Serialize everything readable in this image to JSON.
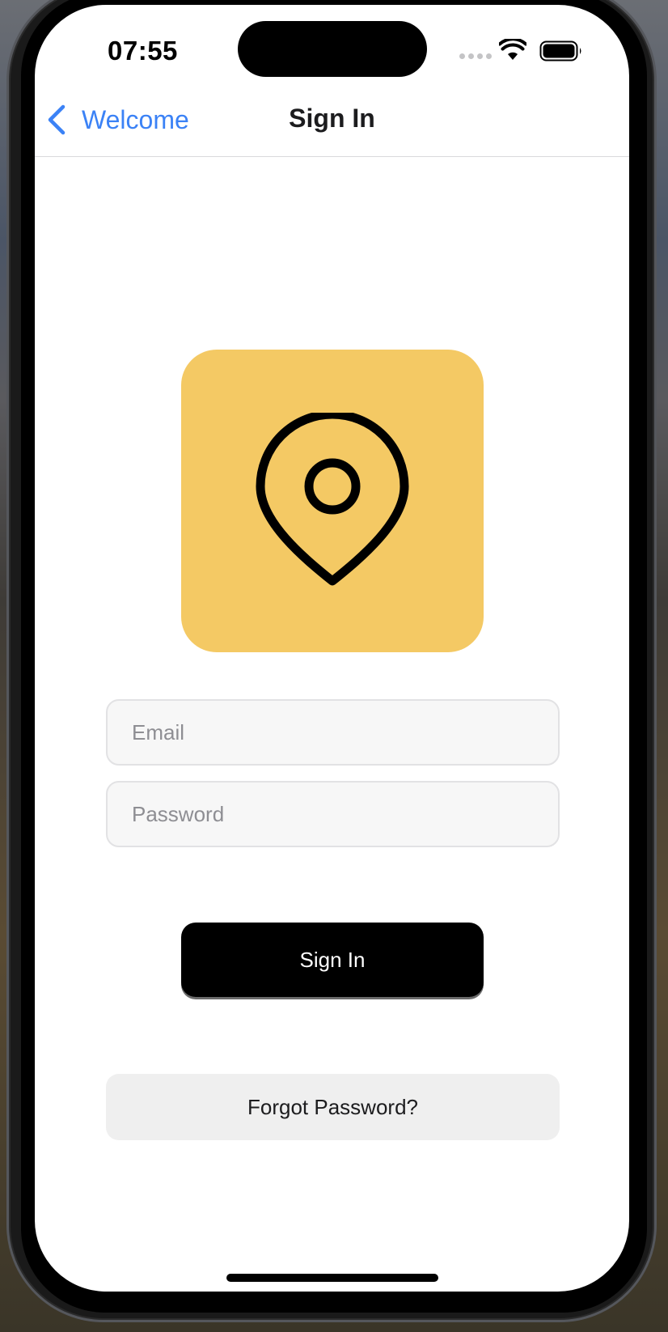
{
  "status_bar": {
    "time": "07:55"
  },
  "nav": {
    "back_label": "Welcome",
    "title": "Sign In"
  },
  "form": {
    "email_placeholder": "Email",
    "email_value": "",
    "password_placeholder": "Password",
    "password_value": "",
    "signin_label": "Sign In",
    "forgot_label": "Forgot Password?"
  },
  "icons": {
    "back": "chevron-left-icon",
    "logo": "map-pin-icon",
    "wifi": "wifi-icon",
    "battery": "battery-icon"
  },
  "colors": {
    "accent": "#3b82f6",
    "logo_background": "#f4c964",
    "primary_button": "#000000",
    "secondary_button": "#efefef"
  }
}
